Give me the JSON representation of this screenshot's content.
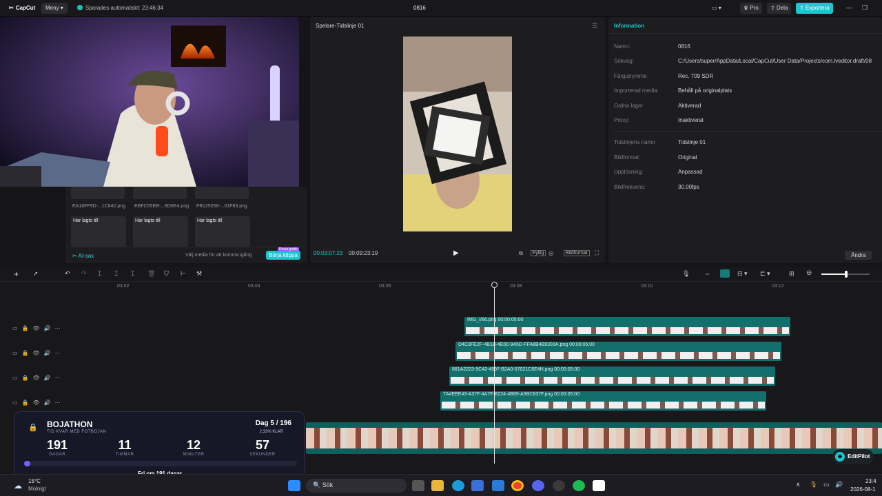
{
  "app": {
    "brand": "CapCut",
    "menu_label": "Meny",
    "saved_status": "Sparades automatiskt: 23:46:34",
    "project_name": "0816",
    "pro_label": "Pro",
    "share_label": "Dela",
    "export_label": "Exportera"
  },
  "media": {
    "items": [
      {
        "name": "EA18FF9D-...1C842.png"
      },
      {
        "name": "EBFC65EB-...8D6E4.png"
      },
      {
        "name": "FB125058-...01F83.png"
      }
    ],
    "added_label": "Har lagts till",
    "ai_label": "AI-sax",
    "hint": "Välj media för att komma igång",
    "start_button": "Börja klippa",
    "free_badge": "Prova gratis"
  },
  "player": {
    "title": "Spelare-Tidslinje 01",
    "current_time": "00:03:07:23",
    "total_time": "00:09:23:19",
    "fit_label": "Fyllig",
    "ratio_label": "Bildformat"
  },
  "info": {
    "title": "Information",
    "rows": [
      {
        "label": "Namn:",
        "value": "0816"
      },
      {
        "label": "Sökväg:",
        "value": "C:/Users/super/AppData/Local/CapCut/User Data/Projects/com.lveditor.draft/08"
      },
      {
        "label": "Färgutrymme",
        "value": "Rec. 709 SDR"
      },
      {
        "label": "Importerad media:",
        "value": "Behåll på originalplats"
      },
      {
        "label": "Ordna lager",
        "value": "Aktiverad"
      },
      {
        "label": "Proxy:",
        "value": "Inaktiverat"
      },
      {
        "label": "Tidslinjens namn",
        "value": "Tidslinje 01"
      },
      {
        "label": "Bildformat:",
        "value": "Original"
      },
      {
        "label": "Upplösning:",
        "value": "Anpassad"
      },
      {
        "label": "Bildfrekvens:",
        "value": "30.00fps"
      }
    ],
    "edit_button": "Ändra"
  },
  "timeline": {
    "ruler": [
      "03:02",
      "03:04",
      "03:06",
      "03:08",
      "03:10",
      "03:12"
    ],
    "clips": [
      {
        "name": "IMG_//66.png",
        "duration": "00:00:05:00"
      },
      {
        "name": "D4C3FE2F-4B1B-4E00-9A5D-FFA8B4B9303A.png",
        "duration": "00:00:05:00"
      },
      {
        "name": "881A2223-9C42-4997-B2A0-07021C6E4H.png",
        "duration": "00:00:05:00"
      },
      {
        "name": "7A4EEE43-A37F-4A7F-B224-4B89-A5BC837F.png",
        "duration": "00:00:05:00"
      }
    ],
    "editpilot_label": "EditPilot"
  },
  "overlay": {
    "title": "BOJATHON",
    "subtitle": "TID KVAR MED FOTBOJAN",
    "day_label": "Dag 5 / 196",
    "percent_label": "2.33% KLAR",
    "units": [
      {
        "value": "191",
        "label": "DAGAR"
      },
      {
        "value": "11",
        "label": "TIMMAR"
      },
      {
        "value": "12",
        "label": "MINUTER"
      },
      {
        "value": "57",
        "label": "SEKUNDER"
      }
    ],
    "progress_percent": 2.33,
    "footer": "Fri om 191 dagar"
  },
  "taskbar": {
    "temp": "15°C",
    "weather": "Molnigt",
    "search_label": "Sök",
    "time": "23:4",
    "date": "2026-08-1"
  },
  "colors": {
    "accent": "#1ac6cf",
    "clip": "#136f6c",
    "overlay_bg": "#16182a"
  }
}
